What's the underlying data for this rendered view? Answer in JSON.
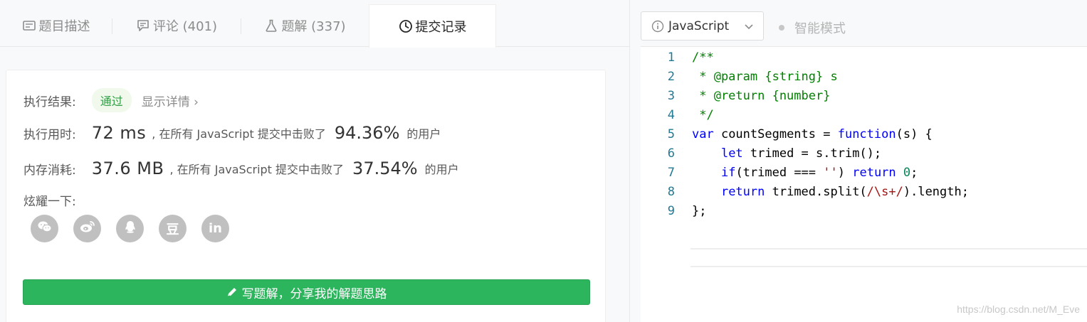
{
  "tabs": [
    {
      "label": "题目描述",
      "icon": "description-icon"
    },
    {
      "label": "评论 (401)",
      "icon": "comment-icon"
    },
    {
      "label": "题解 (337)",
      "icon": "flask-icon"
    },
    {
      "label": "提交记录",
      "icon": "clock-icon"
    }
  ],
  "result": {
    "status_label": "执行结果:",
    "status_value": "通过",
    "detail_link": "显示详情",
    "time_label": "执行用时:",
    "time_value": "72 ms",
    "time_text": ", 在所有 JavaScript 提交中击败了",
    "time_percent": "94.36%",
    "time_suffix": "的用户",
    "memory_label": "内存消耗:",
    "memory_value": "37.6 MB",
    "memory_text": ", 在所有 JavaScript 提交中击败了",
    "memory_percent": "37.54%",
    "memory_suffix": "的用户",
    "share_label": "炫耀一下:"
  },
  "share_buttons": [
    {
      "name": "wechat-icon"
    },
    {
      "name": "weibo-icon"
    },
    {
      "name": "qq-icon"
    },
    {
      "name": "douban-icon",
      "glyph": "豆"
    },
    {
      "name": "linkedin-icon",
      "glyph": "in"
    }
  ],
  "write_solution_label": "写题解，分享我的解题思路",
  "editor": {
    "language": "JavaScript",
    "smart_mode_label": "智能模式",
    "lines": [
      {
        "n": "1"
      },
      {
        "n": "2"
      },
      {
        "n": "3"
      },
      {
        "n": "4"
      },
      {
        "n": "5"
      },
      {
        "n": "6"
      },
      {
        "n": "7"
      },
      {
        "n": "8"
      },
      {
        "n": "9"
      }
    ]
  },
  "watermark": "https://blog.csdn.net/M_Eve",
  "colors": {
    "accent_green": "#2db55d",
    "line_number": "#237893",
    "comment": "#008000",
    "keyword": "#0000ff"
  }
}
